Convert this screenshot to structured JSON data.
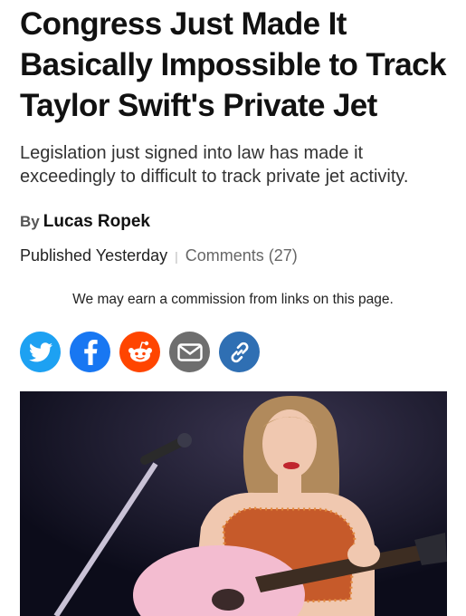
{
  "article": {
    "headline": "Congress Just Made It Basically Impossible to Track Taylor Swift's Private Jet",
    "subhead": "Legislation just signed into law has made it exceedingly to difficult to track private jet activity.",
    "byline_prefix": "By",
    "author": "Lucas Ropek",
    "published": "Published Yesterday",
    "comments": "Comments (27)",
    "commission_notice": "We may earn a commission from links on this page."
  },
  "share": {
    "buttons": [
      {
        "icon": "twitter-icon",
        "color": "#1da1f2"
      },
      {
        "icon": "facebook-icon",
        "color": "#1877f2"
      },
      {
        "icon": "reddit-icon",
        "color": "#ff4500"
      },
      {
        "icon": "email-icon",
        "color": "#6e6e6e"
      },
      {
        "icon": "link-icon",
        "color": "#2f6fb3"
      }
    ]
  },
  "hero_image": {
    "subject": "Taylor Swift performing with a pink acoustic guitar and microphone stand"
  }
}
